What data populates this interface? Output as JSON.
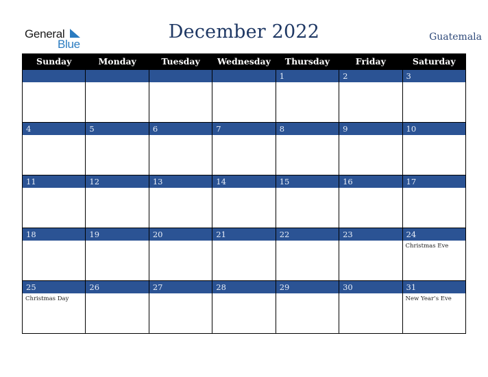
{
  "logo": {
    "line1": "General",
    "line2": "Blue"
  },
  "header": {
    "title": "December 2022",
    "country": "Guatemala"
  },
  "colors": {
    "header_bg": "#000000",
    "daybar_bg": "#2b5394",
    "title": "#1f3864",
    "logo_blue": "#2a7bc0"
  },
  "weekdays": [
    "Sunday",
    "Monday",
    "Tuesday",
    "Wednesday",
    "Thursday",
    "Friday",
    "Saturday"
  ],
  "weeks": [
    [
      {
        "day": "",
        "holiday": ""
      },
      {
        "day": "",
        "holiday": ""
      },
      {
        "day": "",
        "holiday": ""
      },
      {
        "day": "",
        "holiday": ""
      },
      {
        "day": "1",
        "holiday": ""
      },
      {
        "day": "2",
        "holiday": ""
      },
      {
        "day": "3",
        "holiday": ""
      }
    ],
    [
      {
        "day": "4",
        "holiday": ""
      },
      {
        "day": "5",
        "holiday": ""
      },
      {
        "day": "6",
        "holiday": ""
      },
      {
        "day": "7",
        "holiday": ""
      },
      {
        "day": "8",
        "holiday": ""
      },
      {
        "day": "9",
        "holiday": ""
      },
      {
        "day": "10",
        "holiday": ""
      }
    ],
    [
      {
        "day": "11",
        "holiday": ""
      },
      {
        "day": "12",
        "holiday": ""
      },
      {
        "day": "13",
        "holiday": ""
      },
      {
        "day": "14",
        "holiday": ""
      },
      {
        "day": "15",
        "holiday": ""
      },
      {
        "day": "16",
        "holiday": ""
      },
      {
        "day": "17",
        "holiday": ""
      }
    ],
    [
      {
        "day": "18",
        "holiday": ""
      },
      {
        "day": "19",
        "holiday": ""
      },
      {
        "day": "20",
        "holiday": ""
      },
      {
        "day": "21",
        "holiday": ""
      },
      {
        "day": "22",
        "holiday": ""
      },
      {
        "day": "23",
        "holiday": ""
      },
      {
        "day": "24",
        "holiday": "Christmas Eve"
      }
    ],
    [
      {
        "day": "25",
        "holiday": "Christmas Day"
      },
      {
        "day": "26",
        "holiday": ""
      },
      {
        "day": "27",
        "holiday": ""
      },
      {
        "day": "28",
        "holiday": ""
      },
      {
        "day": "29",
        "holiday": ""
      },
      {
        "day": "30",
        "holiday": ""
      },
      {
        "day": "31",
        "holiday": "New Year’s Eve"
      }
    ]
  ]
}
